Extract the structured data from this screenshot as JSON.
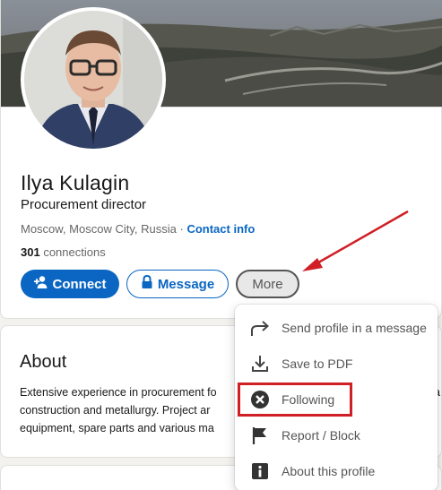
{
  "profile": {
    "name": "Ilya Kulagin",
    "headline": "Procurement director",
    "location": "Moscow, Moscow City, Russia",
    "separator": "·",
    "contact_label": "Contact info",
    "connections_count": "301",
    "connections_label": "connections"
  },
  "actions": {
    "connect_label": "Connect",
    "message_label": "Message",
    "more_label": "More"
  },
  "about": {
    "title": "About",
    "lines": [
      "Extensive experience in procurement fo",
      "construction and metallurgy. Project ar",
      "equipment, spare parts and various ma"
    ],
    "right_edge_char": "a"
  },
  "more_menu": {
    "items": [
      {
        "label": "Send profile in a message",
        "icon": "share-arrow-icon"
      },
      {
        "label": "Save to PDF",
        "icon": "download-icon"
      },
      {
        "label": "Following",
        "icon": "close-circle-icon"
      },
      {
        "label": "Report / Block",
        "icon": "flag-icon"
      },
      {
        "label": "About this profile",
        "icon": "info-icon"
      }
    ]
  },
  "colors": {
    "primary": "#0a66c2",
    "annotation_red": "#d01f25"
  }
}
